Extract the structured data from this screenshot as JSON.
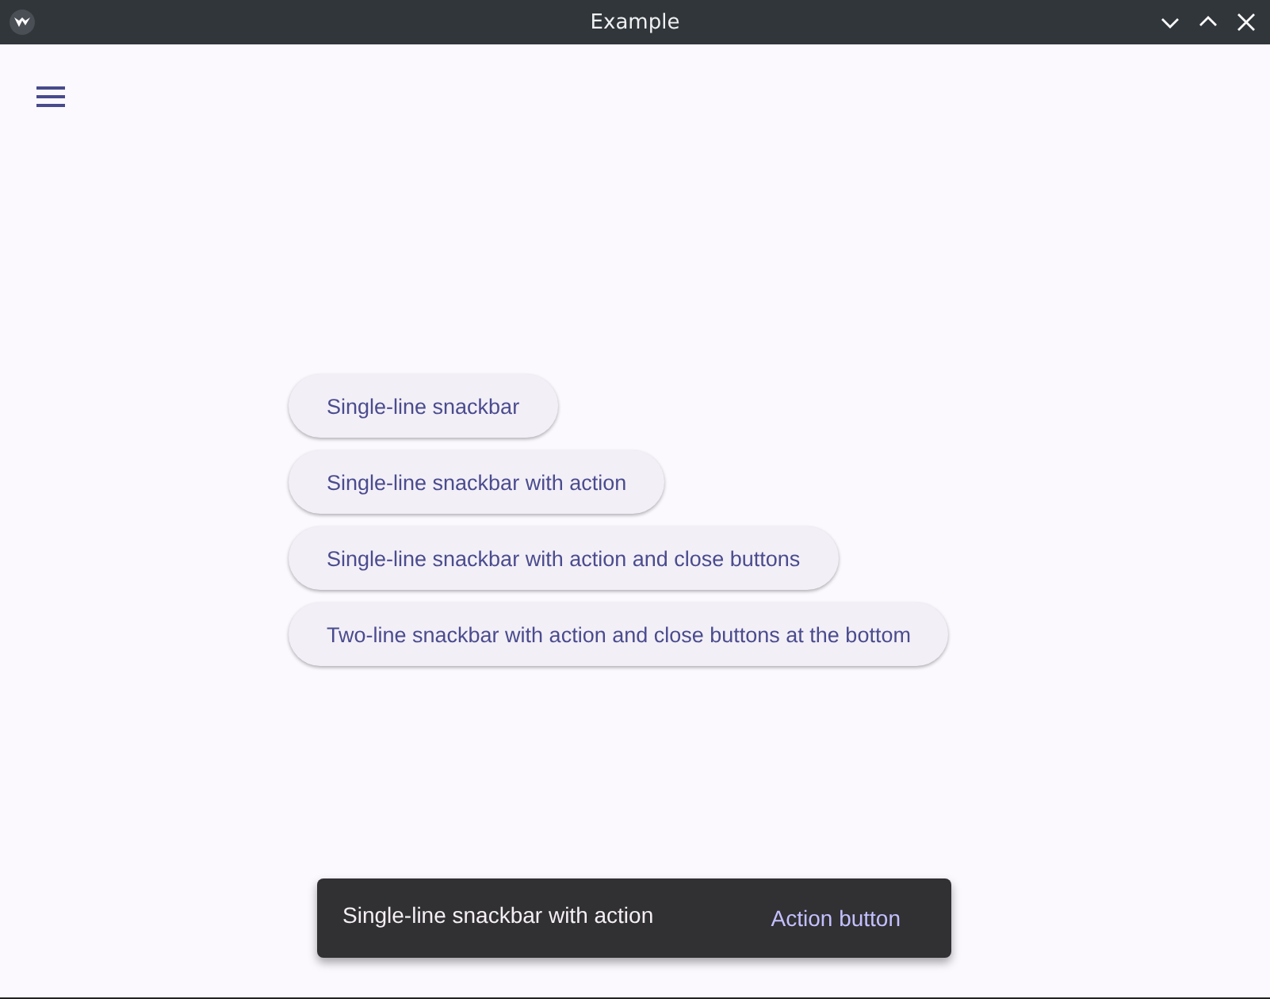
{
  "window": {
    "title": "Example"
  },
  "buttons": [
    "Single-line snackbar",
    "Single-line snackbar with action",
    "Single-line snackbar with action and close buttons",
    "Two-line snackbar with action and close buttons at the bottom"
  ],
  "snackbar": {
    "message": "Single-line snackbar with action",
    "action": "Action button"
  }
}
